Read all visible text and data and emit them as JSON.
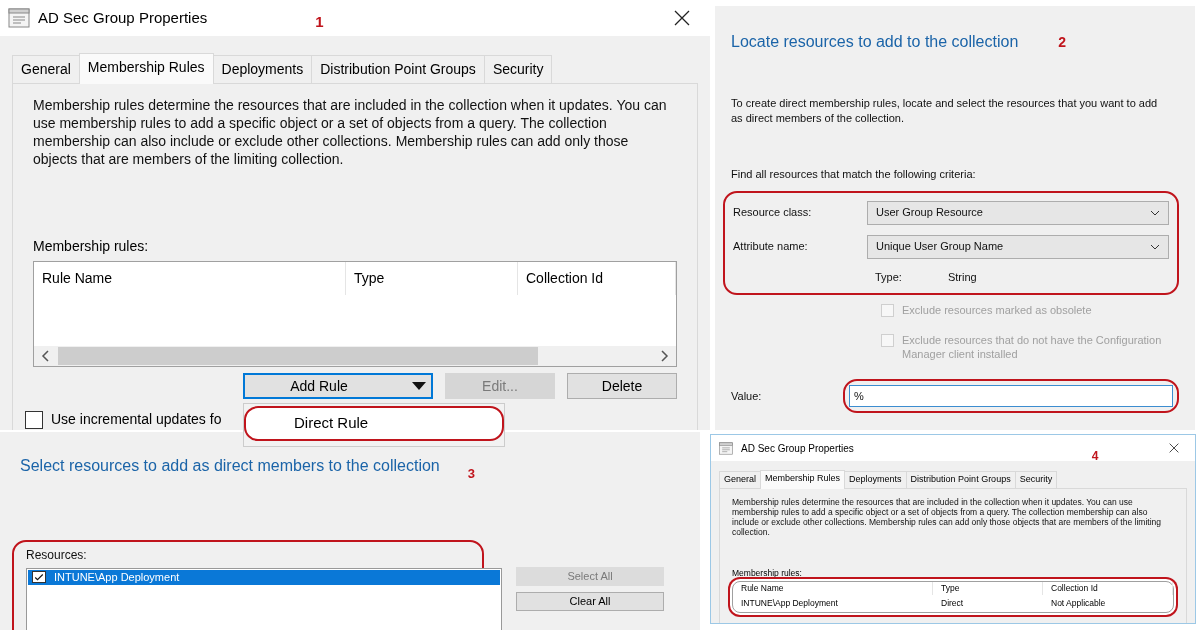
{
  "panels": [
    {
      "kind": "properties",
      "step": "1",
      "title": "AD Sec Group Properties",
      "tabs": [
        {
          "label": "General",
          "selected": false
        },
        {
          "label": "Membership Rules",
          "selected": true
        },
        {
          "label": "Deployments",
          "selected": false
        },
        {
          "label": "Distribution Point Groups",
          "selected": false
        },
        {
          "label": "Security",
          "selected": false
        }
      ],
      "description": "Membership rules determine the resources that are included in the collection when it updates. You can use membership rules to add a specific object or a set of objects from a query. The collection membership can also include or exclude other collections. Membership rules can add only those objects that are members of the limiting collection.",
      "rules_label": "Membership rules:",
      "columns": [
        "Rule Name",
        "Type",
        "Collection Id"
      ],
      "table_circled": false,
      "buttons": [
        {
          "label": "Add Rule",
          "kind": "dropdown",
          "disabled": false,
          "focused": true
        },
        {
          "label": "Edit...",
          "kind": "push",
          "disabled": true,
          "focused": false
        },
        {
          "label": "Delete",
          "kind": "push",
          "disabled": false,
          "focused": false
        }
      ],
      "checkbox": {
        "label": "Use incremental updates fo",
        "checked": false
      },
      "menu": [
        {
          "label": "Direct Rule",
          "circled": true
        }
      ]
    },
    {
      "kind": "locate",
      "step": "2",
      "heading": "Locate resources to add to the collection",
      "intro": "To create direct membership rules, locate and select the resources that you want to add as direct members of the collection.",
      "criteria_label": "Find all resources that match the following criteria:",
      "criteria_circled": true,
      "fields": [
        {
          "label": "Resource class:",
          "value": "User Group Resource"
        },
        {
          "label": "Attribute name:",
          "value": "Unique User Group Name"
        }
      ],
      "type_label": "Type:",
      "type_value": "String",
      "options": [
        {
          "label": "Exclude resources marked as obsolete",
          "checked": false,
          "disabled": true
        },
        {
          "label": "Exclude resources that do not have the Configuration Manager client installed",
          "checked": false,
          "disabled": true
        }
      ],
      "value": {
        "label": "Value:",
        "text": "%",
        "circled": true
      }
    },
    {
      "kind": "select",
      "step": "3",
      "heading": "Select resources to add as direct members to the collection",
      "resources_label": "Resources:",
      "resources_circled": true,
      "items": [
        {
          "label": "INTUNE\\App Deployment",
          "checked": true,
          "selected": true
        }
      ],
      "buttons": [
        {
          "label": "Select All",
          "disabled": true
        },
        {
          "label": "Clear All",
          "disabled": false
        }
      ]
    },
    {
      "kind": "properties",
      "step": "4",
      "title": "AD Sec Group Properties",
      "tabs": [
        {
          "label": "General",
          "selected": false
        },
        {
          "label": "Membership Rules",
          "selected": true
        },
        {
          "label": "Deployments",
          "selected": false
        },
        {
          "label": "Distribution Point Groups",
          "selected": false
        },
        {
          "label": "Security",
          "selected": false
        }
      ],
      "description": "Membership rules determine the resources that are included in the collection when it updates. You can use membership rules to add a specific object or a set of objects from a query. The collection membership can also include or exclude other collections. Membership rules can add only those objects that are members of the limiting collection.",
      "rules_label": "Membership rules:",
      "columns": [
        "Rule Name",
        "Type",
        "Collection Id"
      ],
      "table_circled": true,
      "rows": [
        [
          "INTUNE\\App Deployment",
          "Direct",
          "Not Applicable"
        ]
      ]
    }
  ]
}
